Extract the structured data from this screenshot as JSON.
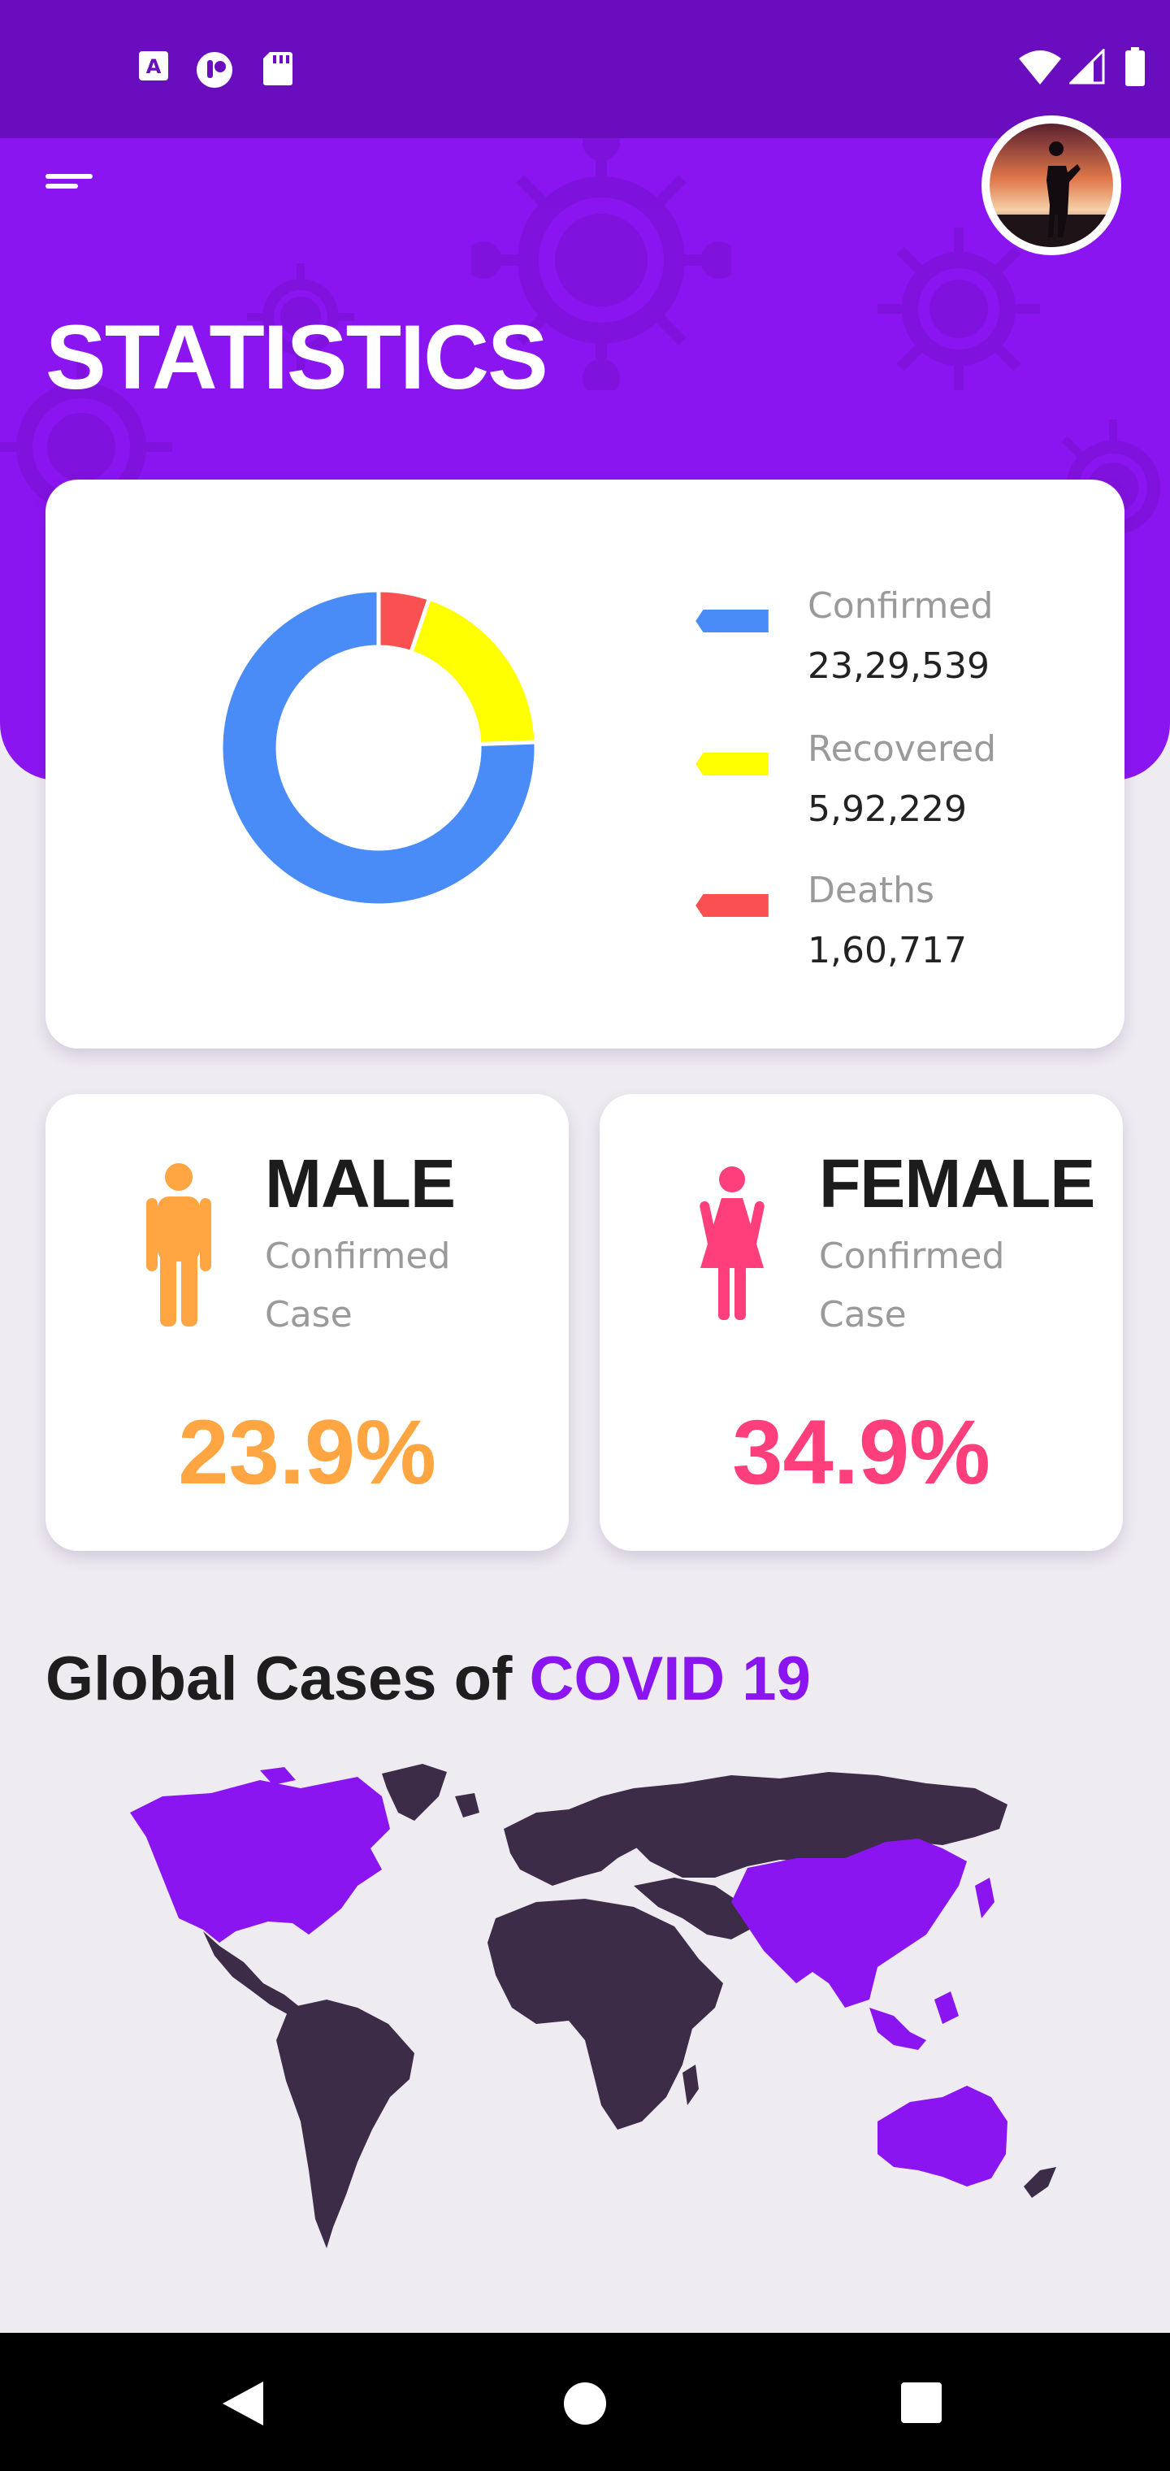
{
  "screen": {
    "title": "STATISTICS"
  },
  "status_bar": {
    "left_icons": [
      "font-a-icon",
      "data-saver-icon",
      "sd-card-icon"
    ],
    "right_icons": [
      "wifi-icon",
      "signal-icon",
      "battery-icon"
    ]
  },
  "colors": {
    "header": "#8a15f1",
    "status_bar": "#6a0dbf",
    "confirmed": "#4a8cf7",
    "recovered": "#ffff00",
    "deaths": "#fb5052",
    "male": "#ffa541",
    "female": "#ff3f7c",
    "accent": "#8a15f1",
    "map_land": "#3d2c48"
  },
  "stats": {
    "items": [
      {
        "label": "Confirmed",
        "value": "23,29,539",
        "color": "#4a8cf7"
      },
      {
        "label": "Recovered",
        "value": "5,92,229",
        "color": "#ffff00"
      },
      {
        "label": "Deaths",
        "value": "1,60,717",
        "color": "#fb5052"
      }
    ]
  },
  "chart_data": {
    "type": "pie",
    "categories": [
      "Confirmed",
      "Recovered",
      "Deaths"
    ],
    "values": [
      2329539,
      592229,
      160717
    ],
    "colors": [
      "#4a8cf7",
      "#ffff00",
      "#fb5052"
    ],
    "donut": true,
    "legend_position": "right"
  },
  "gender": {
    "male": {
      "title": "MALE",
      "subtitle": "Confirmed Case",
      "percent": "23.9%"
    },
    "female": {
      "title": "FEMALE",
      "subtitle": "Confirmed Case",
      "percent": "34.9%"
    }
  },
  "global": {
    "title_prefix": "Global Cases of ",
    "title_highlight": "COVID 19"
  },
  "nav": {
    "icons": [
      "back-icon",
      "home-icon",
      "recents-icon"
    ]
  }
}
